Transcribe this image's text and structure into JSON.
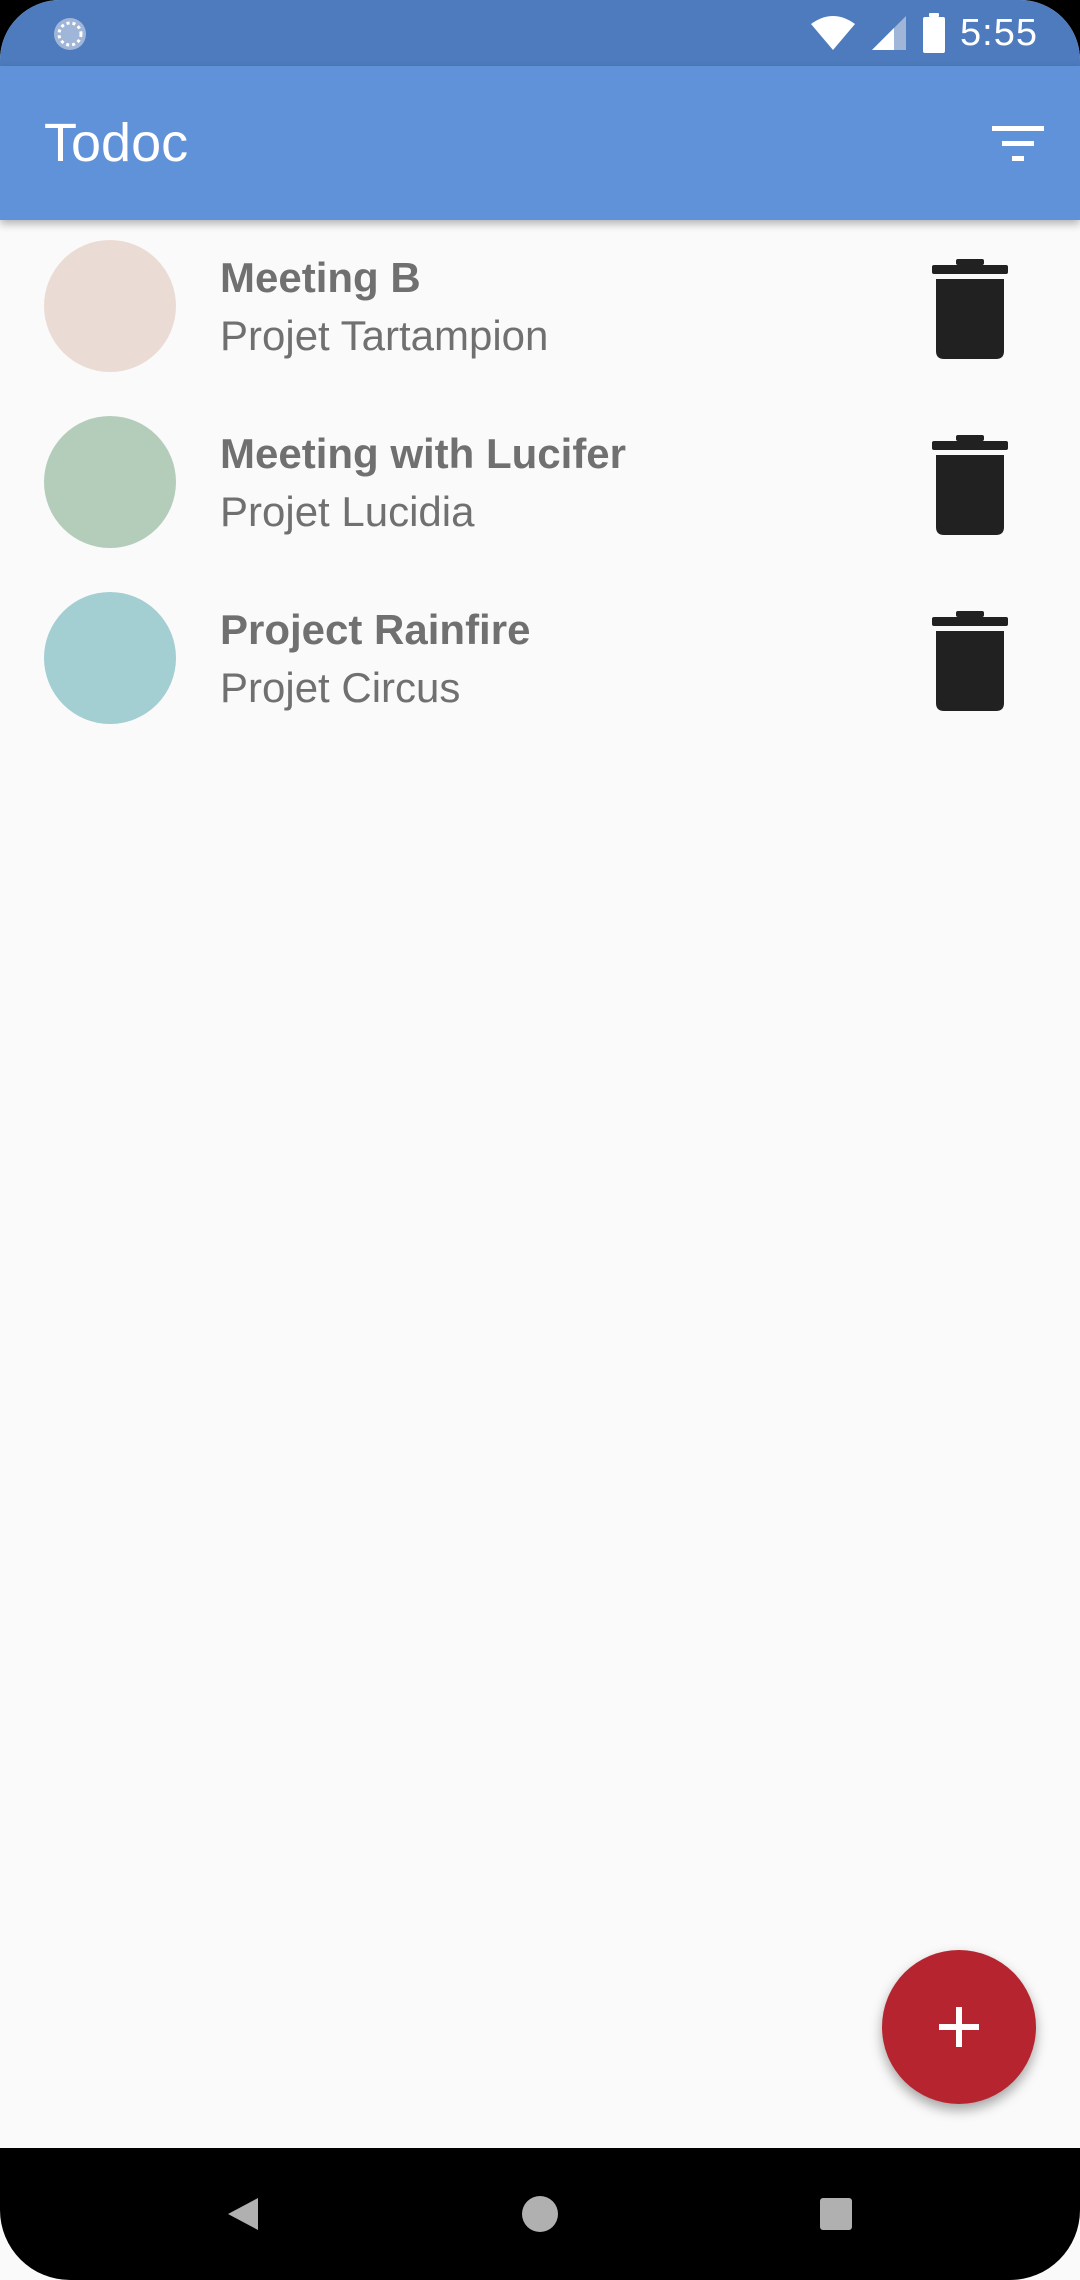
{
  "status_bar": {
    "time": "5:55",
    "icons": [
      "sync-icon",
      "wifi-icon",
      "cellular-signal-icon",
      "battery-icon"
    ]
  },
  "app_bar": {
    "title": "Todoc",
    "actions": [
      "filter-icon"
    ]
  },
  "tasks": [
    {
      "name": "Meeting B",
      "project": "Projet Tartampion",
      "color": "#ebdbd5"
    },
    {
      "name": "Meeting with Lucifer",
      "project": "Projet Lucidia",
      "color": "#b4cdbb"
    },
    {
      "name": "Project Rainfire",
      "project": "Projet Circus",
      "color": "#a3ced2"
    }
  ],
  "fab": {
    "icon": "plus-icon",
    "color": "#b6252f"
  },
  "nav_bar": {
    "buttons": [
      "back-icon",
      "home-icon",
      "recents-icon"
    ]
  },
  "colors": {
    "status_bar": "#4e7bbd",
    "app_bar": "#6092d9",
    "background": "#fafafa",
    "text": "#707070",
    "icon_dark": "#212121"
  }
}
